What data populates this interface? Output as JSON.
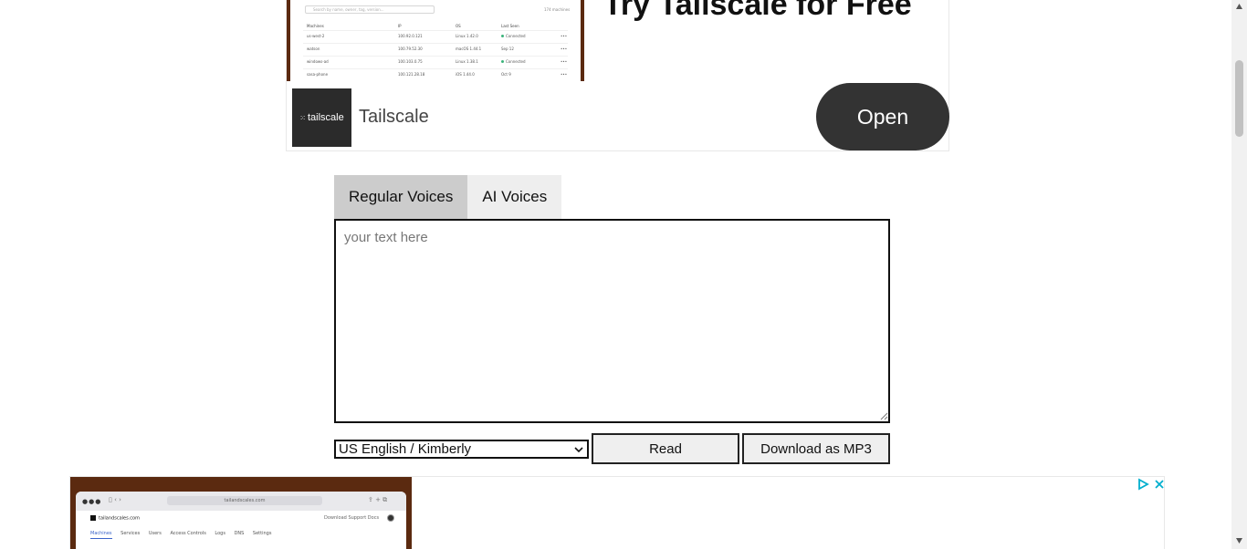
{
  "top_ad": {
    "headline": "Try Tailscale for Free",
    "brand_logo_text": "tailscale",
    "brand_name": "Tailscale",
    "open_label": "Open",
    "preview": {
      "search_placeholder": "Search by name, owner, tag, version...",
      "count": "174 machines",
      "headers": [
        "Machines",
        "IP",
        "OS",
        "Last Seen"
      ],
      "rows": [
        {
          "name": "us-west-2",
          "ip": "100.92.0.121",
          "os": "Linux 1.42.0",
          "status": "Connected"
        },
        {
          "name": "watson",
          "ip": "100.79.52.30",
          "os": "macOS 1.44.1",
          "status": "Sep 12"
        },
        {
          "name": "windows-ad",
          "ip": "100.103.0.75",
          "os": "Linux 1.38.1",
          "status": "Connected"
        },
        {
          "name": "sasa-phone",
          "ip": "100.121.28.18",
          "os": "iOS 1.44.0",
          "status": "Oct 9"
        }
      ]
    }
  },
  "tabs": [
    {
      "label": "Regular Voices",
      "active": true
    },
    {
      "label": "AI Voices",
      "active": false
    }
  ],
  "textarea": {
    "placeholder": "your text here",
    "value": ""
  },
  "voice_select": {
    "selected": "US English / Kimberly"
  },
  "buttons": {
    "read": "Read",
    "download": "Download as MP3"
  },
  "bottom_ad": {
    "url": "tailandscales.com",
    "site_name": "tailandscales.com",
    "top_links": "Download   Support   Docs",
    "menu": [
      "Machines",
      "Services",
      "Users",
      "Access Controls",
      "Logs",
      "DNS",
      "Settings"
    ]
  },
  "colors": {
    "ad_frame": "#5b2a10",
    "open_button": "#333333",
    "tab_active": "#cccccc",
    "tab_inactive": "#eeeeee",
    "adchoices": "#00aecd"
  }
}
